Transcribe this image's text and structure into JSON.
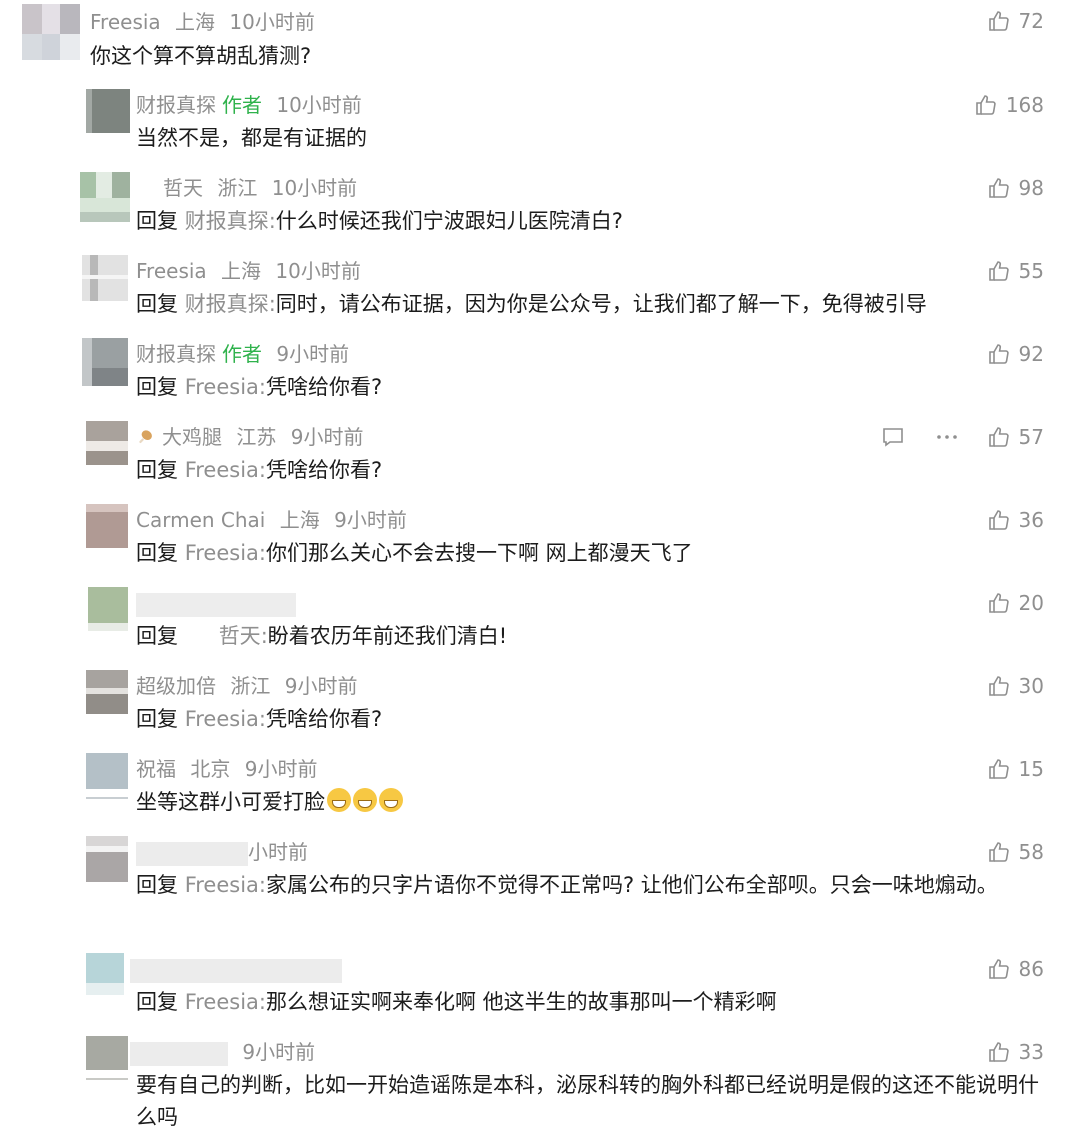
{
  "comments": [
    {
      "name": "Freesia",
      "location": "上海",
      "time": "10小时前",
      "likes": "72",
      "text": "你这个算不算胡乱猜测?"
    },
    {
      "name": "财报真探",
      "author_tag": "作者",
      "time": "10小时前",
      "likes": "168",
      "text": "当然不是，都是有证据的"
    },
    {
      "name": "哲天",
      "location": "浙江",
      "time": "10小时前",
      "likes": "98",
      "reply_label": "回复",
      "reply_to": "财报真探",
      "text": "什么时候还我们宁波跟妇儿医院清白?"
    },
    {
      "name": "Freesia",
      "location": "上海",
      "time": "10小时前",
      "likes": "55",
      "reply_label": "回复",
      "reply_to": "财报真探",
      "text": "同时，请公布证据，因为你是公众号，让我们都了解一下，免得被引导"
    },
    {
      "name": "财报真探",
      "author_tag": "作者",
      "time": "9小时前",
      "likes": "92",
      "reply_label": "回复",
      "reply_to": "Freesia",
      "text": "凭啥给你看?"
    },
    {
      "name": "大鸡腿",
      "location": "江苏",
      "time": "9小时前",
      "likes": "57",
      "reply_label": "回复",
      "reply_to": "Freesia",
      "text": "凭啥给你看?"
    },
    {
      "name": "Carmen Chai",
      "location": "上海",
      "time": "9小时前",
      "likes": "36",
      "reply_label": "回复",
      "reply_to": "Freesia",
      "text": "你们那么关心不会去搜一下啊 网上都漫天飞了"
    },
    {
      "likes": "20",
      "reply_label": "回复",
      "reply_to": "哲天",
      "text": "盼着农历年前还我们清白!"
    },
    {
      "name": "超级加倍",
      "location": "浙江",
      "time": "9小时前",
      "likes": "30",
      "reply_label": "回复",
      "reply_to": "Freesia",
      "text": "凭啥给你看?"
    },
    {
      "name": "祝福",
      "location": "北京",
      "time": "9小时前",
      "likes": "15",
      "text": "坐等这群小可爱打脸"
    },
    {
      "time": "9小时前",
      "time_visible": "小时前",
      "likes": "58",
      "reply_label": "回复",
      "reply_to": "Freesia",
      "text": "家属公布的只字片语你不觉得不正常吗? 让他们公布全部呗。只会一味地煽动。"
    },
    {
      "likes": "86",
      "reply_label": "回复",
      "reply_to": "Freesia",
      "text": "那么想证实啊来奉化啊 他这半生的故事那叫一个精彩啊"
    },
    {
      "time": "9小时前",
      "likes": "33",
      "text": "要有自己的判断，比如一开始造谣陈是本科，泌尿科转的胸外科都已经说明是假的这还不能说明什么吗"
    }
  ],
  "icons": {
    "like": "thumbs-up-icon",
    "reply": "speech-bubble-icon",
    "more": "more-dots-icon",
    "emoji": "grinning-face-icon"
  },
  "colors": {
    "meta": "#8f8f8f",
    "author_tag": "#2fb24c",
    "text": "#1c1c1c"
  }
}
